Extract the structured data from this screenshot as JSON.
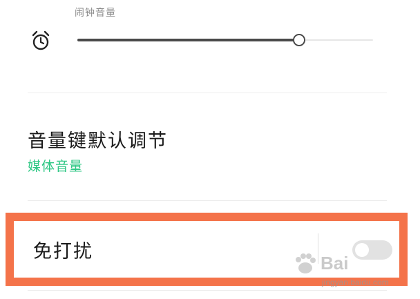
{
  "alarm_volume": {
    "label": "闹钟音量",
    "level_percent": 75,
    "icon": "alarm-clock-icon"
  },
  "volume_key": {
    "title": "音量键默认调节",
    "value": "媒体音量",
    "value_color": "#2ec784"
  },
  "do_not_disturb": {
    "title": "免打扰",
    "toggle_on": false,
    "highlight_color": "#f4734a"
  },
  "watermark": {
    "brand": "Bai",
    "url": "jingyan.baidu.com"
  }
}
